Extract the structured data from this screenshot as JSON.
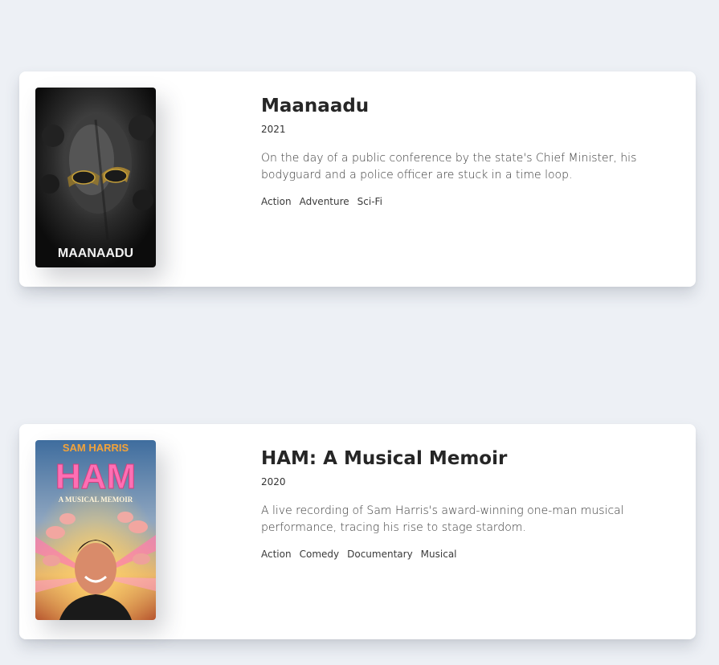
{
  "movies": [
    {
      "title": "Maanaadu",
      "year": "2021",
      "description": "On the day of a public conference by the state's Chief Minister, his bodyguard and a police officer are stuck in a time loop.",
      "genres": [
        "Action",
        "Adventure",
        "Sci-Fi"
      ],
      "poster_text": "MAANAADU"
    },
    {
      "title": "HAM: A Musical Memoir",
      "year": "2020",
      "description": "A live recording of Sam Harris's award-winning one-man musical performance, tracing his rise to stage stardom.",
      "genres": [
        "Action",
        "Comedy",
        "Documentary",
        "Musical"
      ],
      "poster_top_text": "SAM HARRIS",
      "poster_title_text": "HAM",
      "poster_sub_text": "A MUSICAL MEMOIR"
    }
  ]
}
